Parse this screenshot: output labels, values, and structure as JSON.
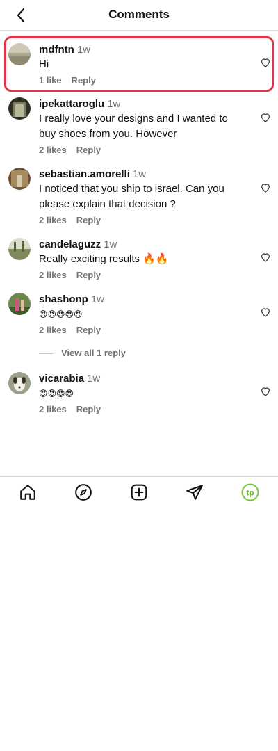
{
  "header": {
    "title": "Comments"
  },
  "comments": [
    {
      "username": "mdfntn",
      "time": "1w",
      "text": [
        "Hi"
      ],
      "likes": "1 like",
      "reply": "Reply"
    },
    {
      "username": "ipekattaroglu",
      "time": "1w",
      "text": [
        "I really love your designs and I wanted to",
        "buy shoes from you. However"
      ],
      "likes": "2 likes",
      "reply": "Reply"
    },
    {
      "username": "sebastian.amorelli",
      "time": "1w",
      "text": [
        "I noticed that you ship to israel. Can you",
        "please explain that decision ?"
      ],
      "likes": "2 likes",
      "reply": "Reply"
    },
    {
      "username": "candelaguzz",
      "time": "1w",
      "text": [
        "Really exciting results 🔥🔥"
      ],
      "likes": "2 likes",
      "reply": "Reply"
    },
    {
      "username": "shashonp",
      "time": "1w",
      "text": [
        "😍😍😍😍😍"
      ],
      "likes": "2 likes",
      "reply": "Reply"
    },
    {
      "username": "vicarabia",
      "time": "1w",
      "text": [
        "😍😍😍😍"
      ],
      "likes": "2 likes",
      "reply": "Reply"
    }
  ],
  "view_replies": "View all 1 reply",
  "nav": {
    "items": [
      "home-icon",
      "explore-icon",
      "new-post-icon",
      "messages-icon",
      "profile-avatar"
    ],
    "profile_initials": "tp"
  },
  "colors": {
    "highlight": "#e03445",
    "muted": "#737373",
    "accent_green": "#7cc53d"
  }
}
